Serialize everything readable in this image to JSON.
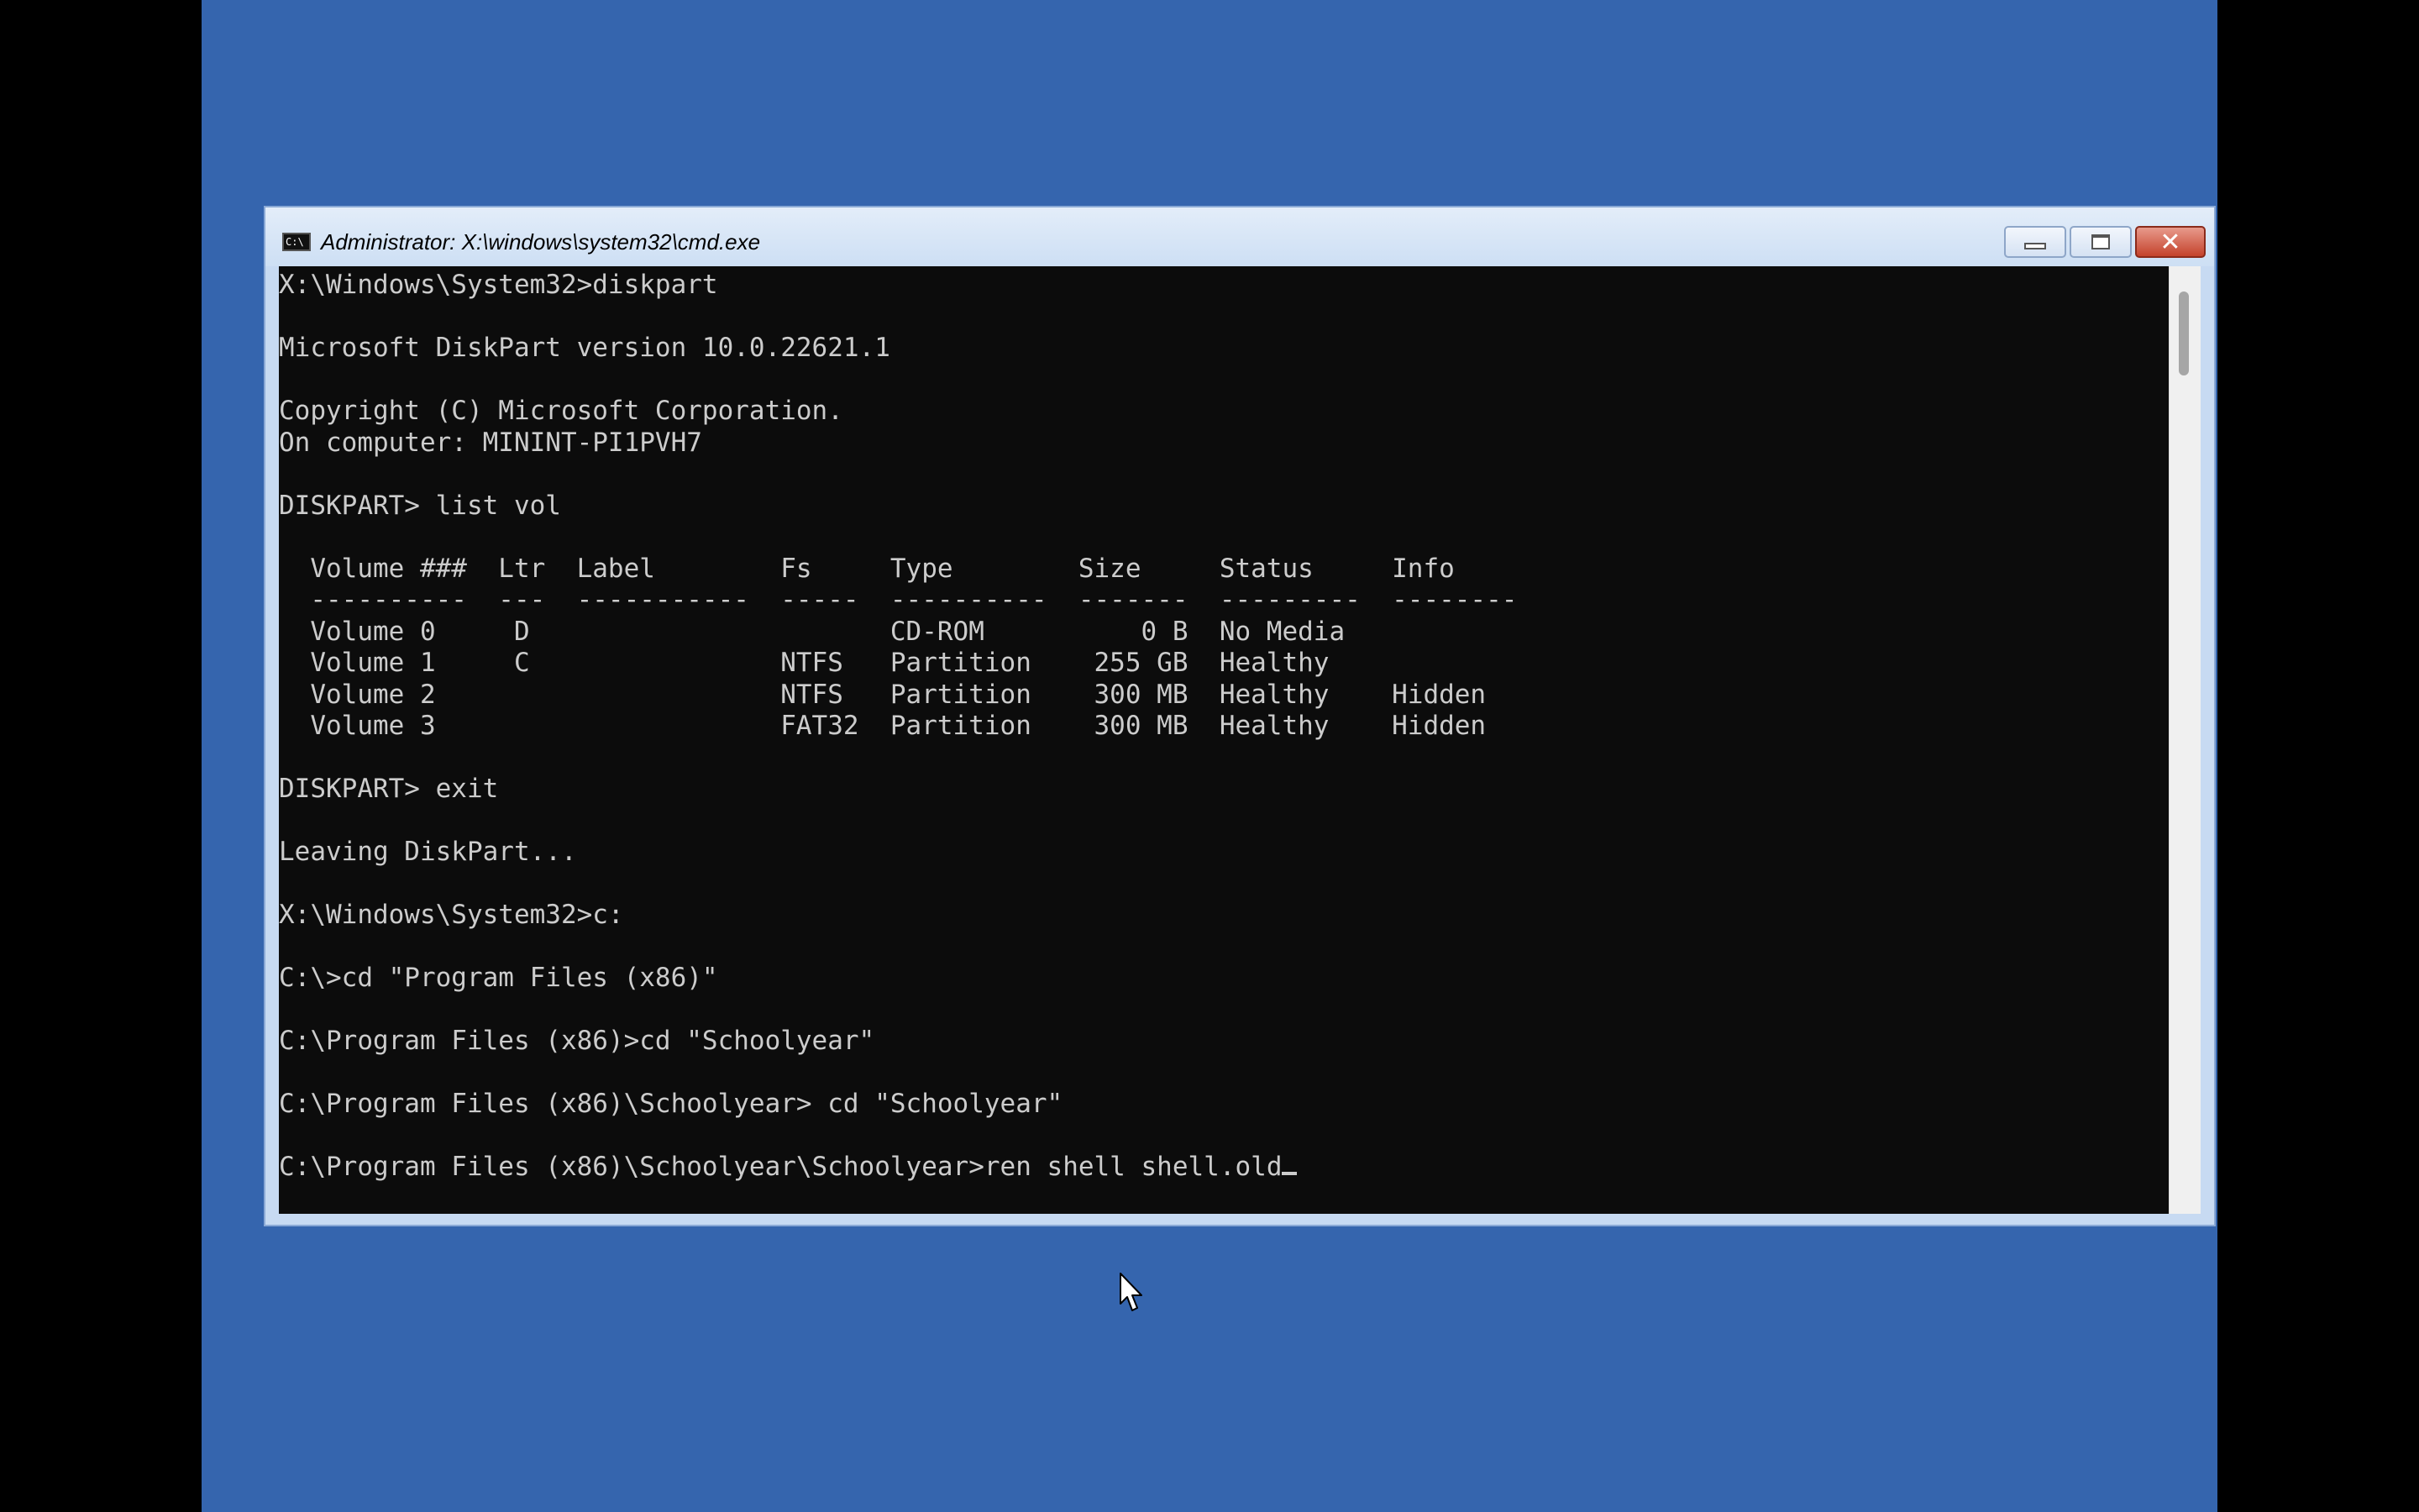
{
  "window": {
    "title": "Administrator: X:\\windows\\system32\\cmd.exe",
    "icon": "cmd-icon",
    "icon_glyph": "C:\\"
  },
  "controls": {
    "minimize": "minimize-icon",
    "maximize": "maximize-icon",
    "close": "close-icon",
    "close_glyph": "✕"
  },
  "colors": {
    "desktop": "#3565ae",
    "console_bg": "#0c0c0c",
    "console_fg": "#cccccc"
  },
  "console": {
    "lines": [
      "X:\\Windows\\System32>diskpart",
      "",
      "Microsoft DiskPart version 10.0.22621.1",
      "",
      "Copyright (C) Microsoft Corporation.",
      "On computer: MININT-PI1PVH7",
      "",
      "DISKPART> list vol",
      "",
      "  Volume ###  Ltr  Label        Fs     Type        Size     Status     Info",
      "  ----------  ---  -----------  -----  ----------  -------  ---------  --------",
      "  Volume 0     D                       CD-ROM          0 B  No Media",
      "  Volume 1     C                NTFS   Partition    255 GB  Healthy",
      "  Volume 2                      NTFS   Partition    300 MB  Healthy    Hidden",
      "  Volume 3                      FAT32  Partition    300 MB  Healthy    Hidden",
      "",
      "DISKPART> exit",
      "",
      "Leaving DiskPart...",
      "",
      "X:\\Windows\\System32>c:",
      "",
      "C:\\>cd \"Program Files (x86)\"",
      "",
      "C:\\Program Files (x86)>cd \"Schoolyear\"",
      "",
      "C:\\Program Files (x86)\\Schoolyear> cd \"Schoolyear\""
    ],
    "current_line": "",
    "prompt": "C:\\Program Files (x86)\\Schoolyear\\Schoolyear>",
    "input": "ren shell shell.old"
  }
}
